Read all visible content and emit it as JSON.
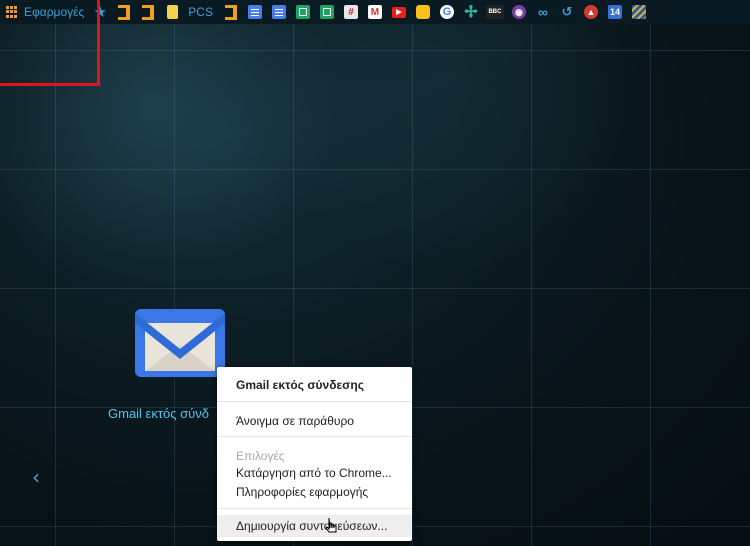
{
  "bookmarks_bar": {
    "apps_label": "Εφαρμογές",
    "items": [
      {
        "icon": "star-icon",
        "color": "#3aa0d8"
      },
      {
        "icon": "bookmark-orange-icon",
        "color": "#f0a020"
      },
      {
        "icon": "bookmark-orange-icon",
        "color": "#f0a020"
      },
      {
        "icon": "folder-icon",
        "color": "#f5d24a"
      },
      {
        "label": "PCS"
      },
      {
        "icon": "bookmark-orange-icon",
        "color": "#f0a020"
      },
      {
        "icon": "google-docs-icon",
        "color": "#4a7ee8"
      },
      {
        "icon": "google-docs-icon",
        "color": "#4a7ee8"
      },
      {
        "icon": "google-sheets-icon",
        "color": "#1fa463"
      },
      {
        "icon": "google-sheets-icon",
        "color": "#1fa463"
      },
      {
        "icon": "slack-icon",
        "color": "#e8e8e8"
      },
      {
        "icon": "gmail-icon",
        "color": "#ffffff"
      },
      {
        "icon": "youtube-icon",
        "color": "#e62117"
      },
      {
        "icon": "keep-icon",
        "color": "#f7c31a"
      },
      {
        "icon": "google-icon",
        "color": "#ffffff"
      },
      {
        "icon": "cross-icon",
        "color": "#2fb7a0"
      },
      {
        "icon": "bbc-icon",
        "label": "BBC",
        "color": "#222222"
      },
      {
        "icon": "eye-icon",
        "color": "#7b3fa0"
      },
      {
        "icon": "infinity-icon",
        "color": "#3aa0d8"
      },
      {
        "icon": "history-icon",
        "color": "#3aa0d8"
      },
      {
        "icon": "warning-icon",
        "color": "#d23b2b"
      },
      {
        "icon": "calendar-icon",
        "label": "14",
        "color": "#3a6fd8"
      },
      {
        "icon": "striped-icon",
        "color": "#2d5aa0"
      }
    ]
  },
  "app_tile": {
    "label": "Gmail εκτός σύνδ"
  },
  "context_menu": {
    "title": "Gmail εκτός σύνδεσης",
    "open_window": "Άνοιγμα σε παράθυρο",
    "options_header": "Επιλογές",
    "remove": "Κατάργηση από το Chrome...",
    "app_info": "Πληροφορίες εφαρμογής",
    "create_shortcuts": "Δημιουργία συντομεύσεων..."
  },
  "nav": {
    "prev_symbol": "‹"
  }
}
